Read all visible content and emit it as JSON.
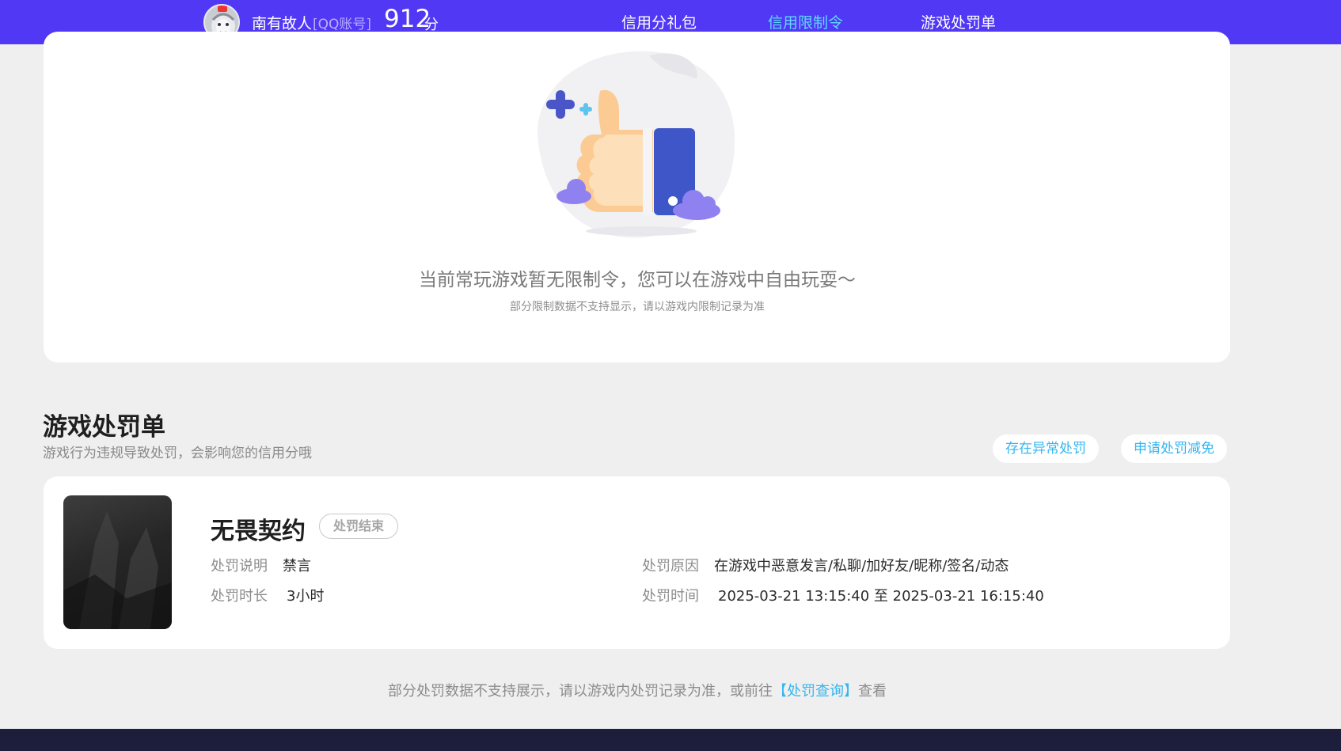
{
  "header": {
    "username": "南有故人",
    "account_type": "[QQ账号]",
    "score": "912",
    "score_unit": "分",
    "tabs": [
      {
        "label": "信用分礼包"
      },
      {
        "label": "信用限制令"
      },
      {
        "label": "游戏处罚单"
      }
    ],
    "active_tab": "信用限制令"
  },
  "restriction": {
    "empty_message": "当前常玩游戏暂无限制令，您可以在游戏中自由玩耍～",
    "empty_note": "部分限制数据不支持显示，请以游戏内限制记录为准"
  },
  "penalty_section": {
    "title": "游戏处罚单",
    "subtitle": "游戏行为违规导致处罚，会影响您的信用分哦",
    "report_abnormal_label": "存在异常处罚",
    "apply_reduction_label": "申请处罚减免"
  },
  "penalty": {
    "game_name": "无畏契约",
    "status": "处罚结束",
    "desc_label": "处罚说明",
    "desc_value": "禁言",
    "duration_label": "处罚时长",
    "duration_value": "3小时",
    "reason_label": "处罚原因",
    "reason_value": "在游戏中恶意发言/私聊/加好友/昵称/签名/动态",
    "time_label": "处罚时间",
    "time_value": "2025-03-21 13:15:40 至 2025-03-21 16:15:40"
  },
  "footer": {
    "note_prefix": "部分处罚数据不支持展示，请以游戏内处罚记录为准，或前往",
    "note_link": "【处罚查询】",
    "note_suffix": "查看"
  },
  "colors": {
    "brand": "#5038f5",
    "accent": "#5fd9ff",
    "link": "#35b6f0",
    "footer_bar": "#1d1e3b"
  }
}
